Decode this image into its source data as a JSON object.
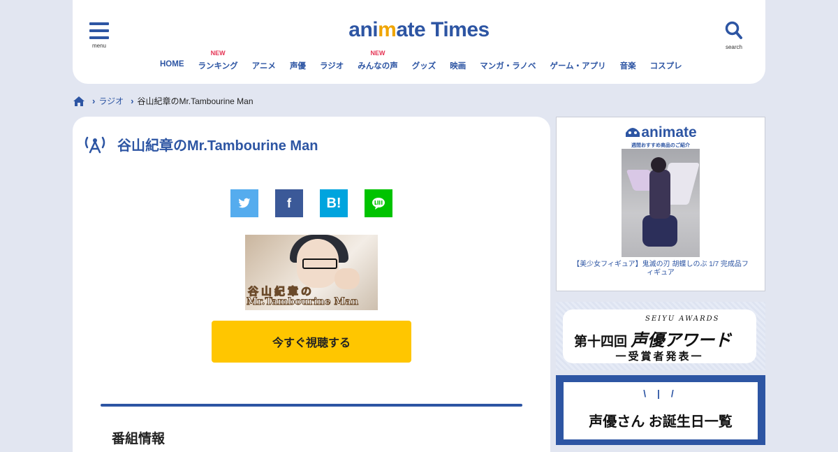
{
  "header": {
    "logo": {
      "part1": "ani",
      "accent": "m",
      "part2": "ate Times"
    },
    "menu_label": "menu",
    "search_label": "search",
    "nav": [
      {
        "label": "HOME",
        "badge": ""
      },
      {
        "label": "ランキング",
        "badge": "NEW"
      },
      {
        "label": "アニメ",
        "badge": ""
      },
      {
        "label": "声優",
        "badge": ""
      },
      {
        "label": "ラジオ",
        "badge": ""
      },
      {
        "label": "みんなの声",
        "badge": "NEW"
      },
      {
        "label": "グッズ",
        "badge": ""
      },
      {
        "label": "映画",
        "badge": ""
      },
      {
        "label": "マンガ・ラノベ",
        "badge": ""
      },
      {
        "label": "ゲーム・アプリ",
        "badge": ""
      },
      {
        "label": "音楽",
        "badge": ""
      },
      {
        "label": "コスプレ",
        "badge": ""
      }
    ]
  },
  "breadcrumb": {
    "category": "ラジオ",
    "current": "谷山紀章のMr.Tambourine Man"
  },
  "main": {
    "title": "谷山紀章のMr.Tambourine Man",
    "share": {
      "twitter_icon": "twitter-icon",
      "facebook_glyph": "f",
      "hatena_glyph": "B!",
      "line_icon": "line-icon"
    },
    "thumbnail": {
      "title_line1": "谷山紀章の",
      "title_line2": "Mr.Tambourine Man"
    },
    "watch_button": "今すぐ視聴する",
    "section_title": "番組情報"
  },
  "sidebar": {
    "ad": {
      "logo": "animate",
      "subtitle": "週間おすすめ商品のご紹介",
      "caption": "【美少女フィギュア】鬼滅の刃 胡蝶しのぶ 1/7 完成品フィギュア"
    },
    "award": {
      "english": "SEIYU AWARDS",
      "prefix": "第十四回",
      "title": "声優アワード",
      "subtitle": "一受賞者発表一"
    },
    "birthday": {
      "dots": "\\ | /",
      "title": "声優さん お誕生日一覧"
    }
  },
  "colors": {
    "brand_blue": "#2d55a3",
    "accent_yellow": "#ffc600",
    "new_badge": "#e53454",
    "background": "#e2e6f1"
  }
}
